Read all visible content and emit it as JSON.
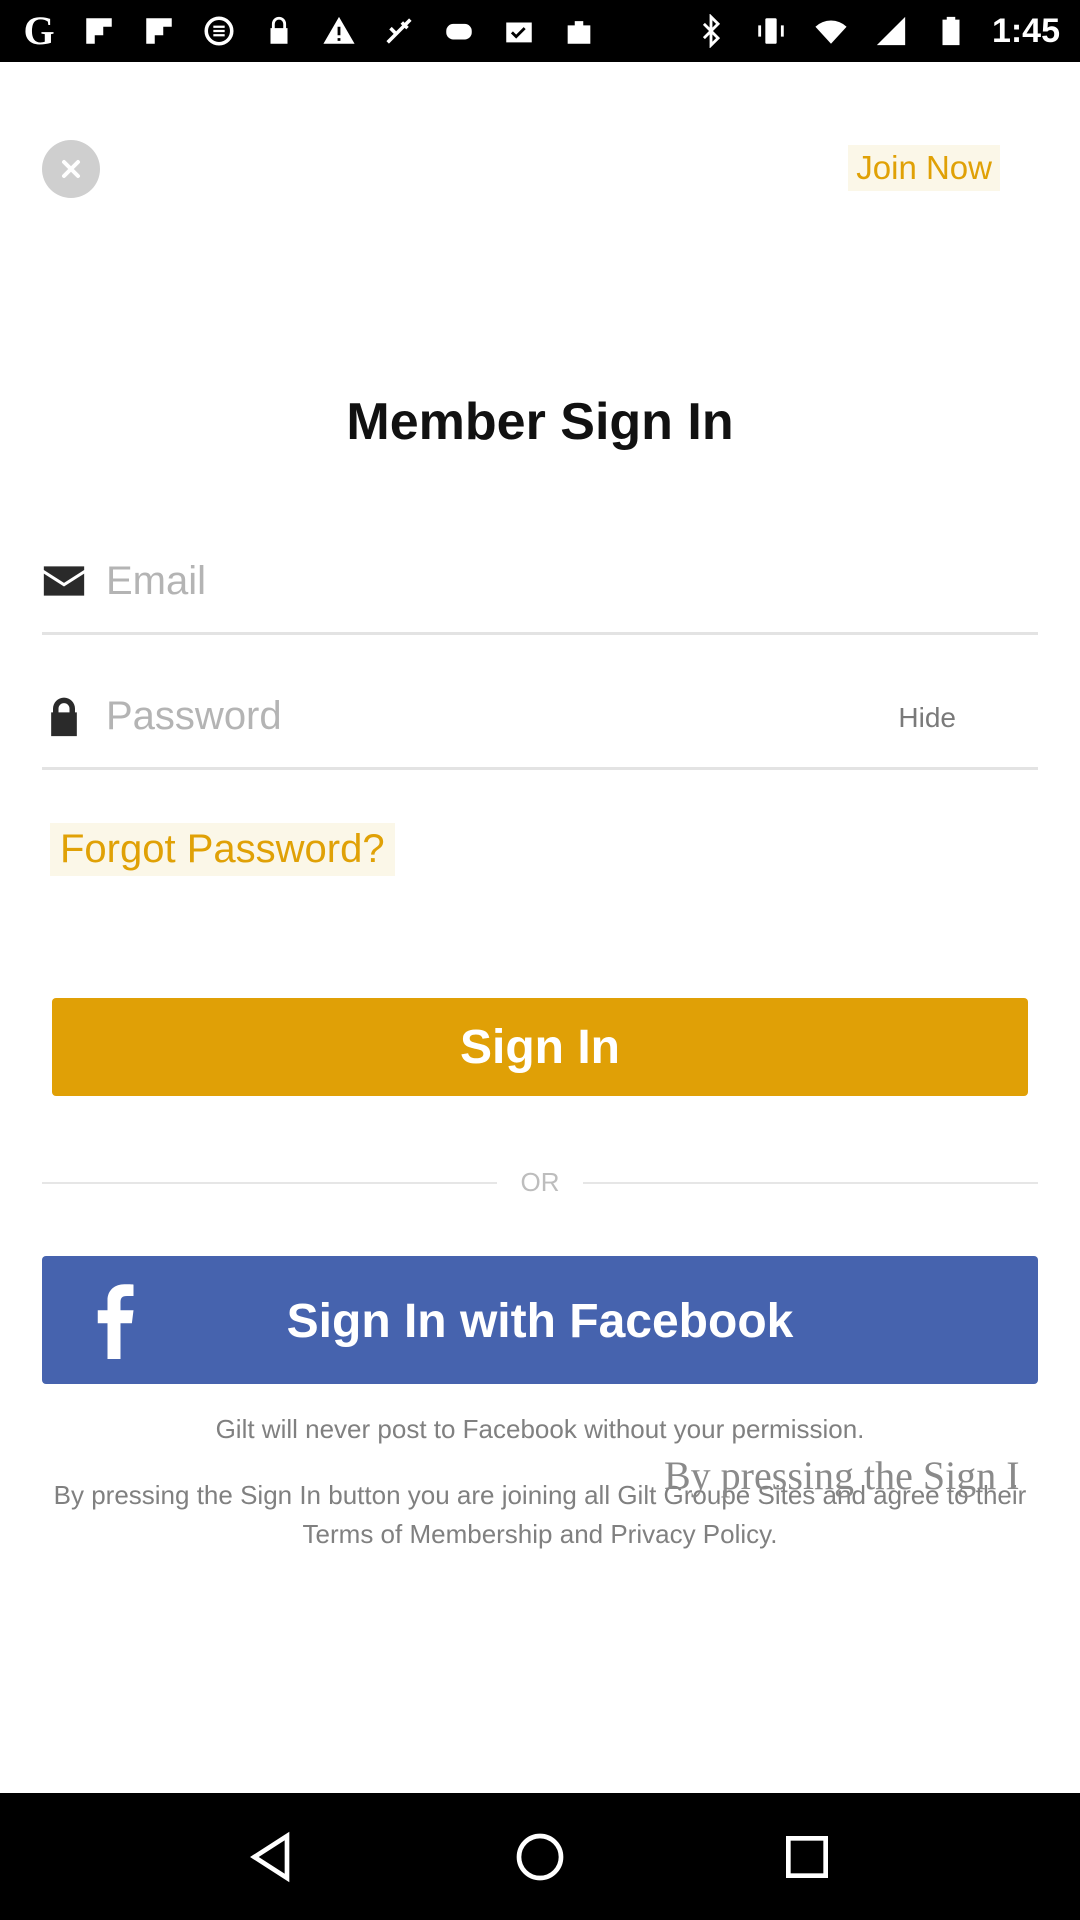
{
  "status_bar": {
    "time": "1:45",
    "left_icons": [
      "google-icon",
      "flipboard-icon",
      "flipboard-icon",
      "sync-icon",
      "lock-icon",
      "warning-icon",
      "fake-gps-icon",
      "game-icon",
      "checkbox-icon",
      "bag-icon"
    ],
    "right_icons": [
      "bluetooth-icon",
      "vibrate-icon",
      "wifi-icon",
      "signal-icon",
      "battery-icon"
    ]
  },
  "header": {
    "join_now_label": "Join Now"
  },
  "title": "Member Sign In",
  "form": {
    "email_placeholder": "Email",
    "email_value": "",
    "password_placeholder": "Password",
    "password_value": "",
    "hide_label": "Hide",
    "forgot_label": "Forgot Password?",
    "signin_label": "Sign In"
  },
  "divider": {
    "or_label": "OR"
  },
  "facebook": {
    "label": "Sign In with Facebook"
  },
  "notes": {
    "permission": "Gilt will never post to Facebook without your permission.",
    "terms": "By pressing the Sign In button you are joining all Gilt Groupe Sites and agree to their Terms of Membership and Privacy Policy.",
    "overlay_fragment": "By pressing the Sign I"
  },
  "colors": {
    "accent": "#e0a006",
    "facebook": "#4663ae",
    "muted_text": "#808080"
  }
}
